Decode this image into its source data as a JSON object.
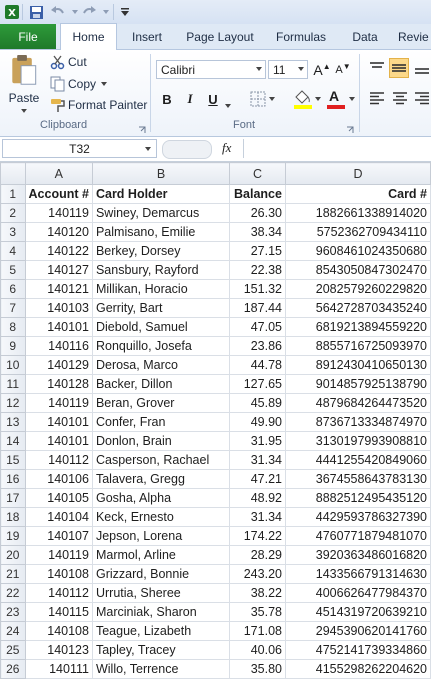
{
  "quick_access": {
    "app_icon": "excel-icon",
    "save_icon": "save-icon",
    "undo_icon": "undo-icon",
    "redo_icon": "redo-icon"
  },
  "tabs": {
    "file": "File",
    "items": [
      "Home",
      "Insert",
      "Page Layout",
      "Formulas",
      "Data",
      "Revie"
    ]
  },
  "clipboard": {
    "paste": "Paste",
    "cut": "Cut",
    "copy": "Copy",
    "format_painter": "Format Painter",
    "group_label": "Clipboard"
  },
  "font": {
    "name": "Calibri",
    "size": "11",
    "bold": "B",
    "italic": "I",
    "underline": "U",
    "grow": "A",
    "shrink": "A",
    "font_color": "A",
    "group_label": "Font"
  },
  "formula_bar": {
    "name_box": "T32",
    "fx": "fx"
  },
  "sheet": {
    "columns": [
      "A",
      "B",
      "C",
      "D"
    ],
    "header": [
      "Account #",
      "Card Holder",
      "Balance",
      "Card #"
    ],
    "rows": [
      [
        "140119",
        "Swiney, Demarcus",
        "26.30",
        "1882661338914020"
      ],
      [
        "140120",
        "Palmisano, Emilie",
        "38.34",
        "5752362709434110"
      ],
      [
        "140122",
        "Berkey, Dorsey",
        "27.15",
        "9608461024350680"
      ],
      [
        "140127",
        "Sansbury, Rayford",
        "22.38",
        "8543050847302470"
      ],
      [
        "140121",
        "Millikan, Horacio",
        "151.32",
        "2082579260229820"
      ],
      [
        "140103",
        "Gerrity, Bart",
        "187.44",
        "5642728703435240"
      ],
      [
        "140101",
        "Diebold, Samuel",
        "47.05",
        "6819213894559220"
      ],
      [
        "140116",
        "Ronquillo, Josefa",
        "23.86",
        "8855716725093970"
      ],
      [
        "140129",
        "Derosa, Marco",
        "44.78",
        "8912430410650130"
      ],
      [
        "140128",
        "Backer, Dillon",
        "127.65",
        "9014857925138790"
      ],
      [
        "140119",
        "Beran, Grover",
        "45.89",
        "4879684264473520"
      ],
      [
        "140101",
        "Confer, Fran",
        "49.90",
        "8736713334874970"
      ],
      [
        "140101",
        "Donlon, Brain",
        "31.95",
        "3130197993908810"
      ],
      [
        "140112",
        "Casperson, Rachael",
        "31.34",
        "4441255420849060"
      ],
      [
        "140106",
        "Talavera, Gregg",
        "47.21",
        "3674558643783130"
      ],
      [
        "140105",
        "Gosha, Alpha",
        "48.92",
        "8882512495435120"
      ],
      [
        "140104",
        "Keck, Ernesto",
        "31.34",
        "4429593786327390"
      ],
      [
        "140107",
        "Jepson, Lorena",
        "174.22",
        "4760771879481070"
      ],
      [
        "140119",
        "Marmol, Arline",
        "28.29",
        "3920363486016820"
      ],
      [
        "140108",
        "Grizzard, Bonnie",
        "243.20",
        "1433566791314630"
      ],
      [
        "140112",
        "Urrutia, Sheree",
        "38.22",
        "4006626477984370"
      ],
      [
        "140115",
        "Marciniak, Sharon",
        "35.78",
        "4514319720639210"
      ],
      [
        "140108",
        "Teague, Lizabeth",
        "171.08",
        "2945390620141760"
      ],
      [
        "140123",
        "Tapley, Tracey",
        "40.06",
        "4752141739334860"
      ],
      [
        "140111",
        "Willo, Terrence",
        "35.80",
        "4155298262204620"
      ]
    ]
  }
}
